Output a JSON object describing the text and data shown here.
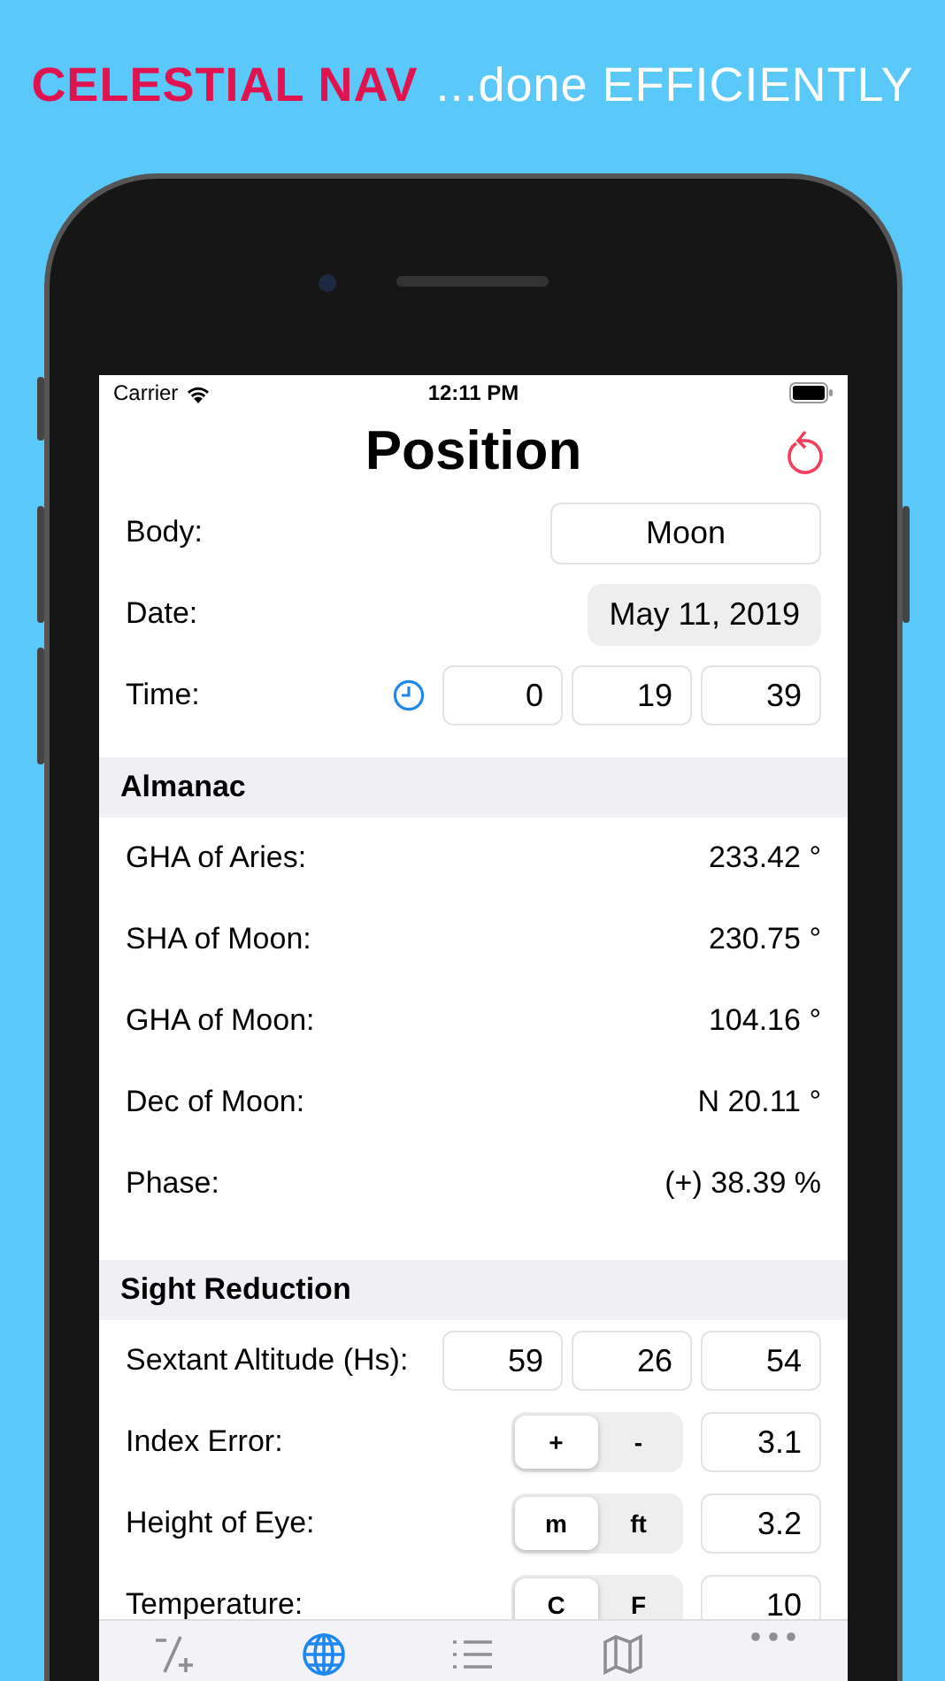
{
  "banner": {
    "brand": "CELESTIAL NAV",
    "tagline": "...done EFFICIENTLY"
  },
  "status_bar": {
    "carrier": "Carrier",
    "time": "12:11 PM"
  },
  "nav": {
    "title": "Position"
  },
  "inputs": [
    {
      "kind": "picker",
      "label": "Body:",
      "value": "Moon"
    },
    {
      "kind": "date",
      "label": "Date:",
      "value": "May 11, 2019"
    },
    {
      "kind": "time",
      "label": "Time:",
      "values": [
        "0",
        "19",
        "39"
      ]
    }
  ],
  "sections": [
    {
      "title": "Almanac",
      "rows": [
        {
          "kind": "value",
          "label": "GHA of Aries:",
          "value": "233.42 °"
        },
        {
          "kind": "value",
          "label": "SHA of Moon:",
          "value": "230.75 °"
        },
        {
          "kind": "value",
          "label": "GHA of Moon:",
          "value": "104.16 °"
        },
        {
          "kind": "value",
          "label": "Dec of Moon:",
          "value": "N 20.11 °"
        },
        {
          "kind": "value",
          "label": "Phase:",
          "value": "(+) 38.39 %"
        }
      ]
    },
    {
      "title": "Sight Reduction",
      "rows": [
        {
          "kind": "triple",
          "label": "Sextant Altitude (Hs):",
          "values": [
            "59",
            "26",
            "54"
          ]
        },
        {
          "kind": "segmented",
          "label": "Index Error:",
          "segments": [
            {
              "label": "+",
              "selected": true
            },
            {
              "label": "-",
              "selected": false
            }
          ],
          "value": "3.1"
        },
        {
          "kind": "segmented",
          "label": "Height of Eye:",
          "segments": [
            {
              "label": "m",
              "selected": true
            },
            {
              "label": "ft",
              "selected": false
            }
          ],
          "value": "3.2"
        },
        {
          "kind": "segmented",
          "label": "Temperature:",
          "segments": [
            {
              "label": "C",
              "selected": true
            },
            {
              "label": "F",
              "selected": false
            }
          ],
          "value": "10"
        }
      ]
    }
  ],
  "tab_bar": {
    "tabs": [
      {
        "selected": false
      },
      {
        "selected": true
      },
      {
        "selected": false
      },
      {
        "selected": false
      },
      {
        "selected": false
      }
    ]
  }
}
